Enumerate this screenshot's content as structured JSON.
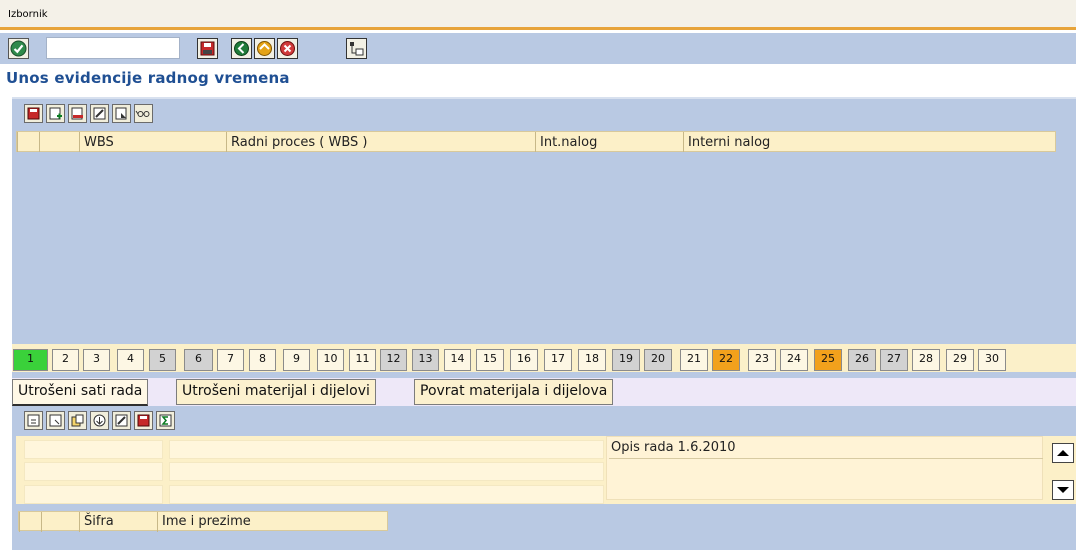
{
  "menu": {
    "label": "Izbornik"
  },
  "toolbar": {
    "command_field": {
      "value": "",
      "placeholder": ""
    },
    "buttons": [
      "save-icon",
      "back-icon",
      "exit-icon",
      "cancel-icon",
      "hierarchy-icon"
    ]
  },
  "page": {
    "title": "Unos evidencije radnog vremena"
  },
  "upper_grid": {
    "columns": [
      "WBS",
      "Radni proces ( WBS )",
      "Int.nalog",
      "Interni nalog"
    ]
  },
  "days": [
    {
      "label": "1",
      "state": "active"
    },
    {
      "label": "2",
      "state": "normal"
    },
    {
      "label": "3",
      "state": "normal"
    },
    {
      "label": "4",
      "state": "normal"
    },
    {
      "label": "5",
      "state": "weekend"
    },
    {
      "label": "6",
      "state": "weekend"
    },
    {
      "label": "7",
      "state": "normal"
    },
    {
      "label": "8",
      "state": "normal"
    },
    {
      "label": "9",
      "state": "normal"
    },
    {
      "label": "10",
      "state": "normal"
    },
    {
      "label": "11",
      "state": "normal"
    },
    {
      "label": "12",
      "state": "weekend"
    },
    {
      "label": "13",
      "state": "weekend"
    },
    {
      "label": "14",
      "state": "normal"
    },
    {
      "label": "15",
      "state": "normal"
    },
    {
      "label": "16",
      "state": "normal"
    },
    {
      "label": "17",
      "state": "normal"
    },
    {
      "label": "18",
      "state": "normal"
    },
    {
      "label": "19",
      "state": "weekend"
    },
    {
      "label": "20",
      "state": "weekend"
    },
    {
      "label": "21",
      "state": "normal"
    },
    {
      "label": "22",
      "state": "holiday"
    },
    {
      "label": "23",
      "state": "normal"
    },
    {
      "label": "24",
      "state": "normal"
    },
    {
      "label": "25",
      "state": "holiday"
    },
    {
      "label": "26",
      "state": "weekend"
    },
    {
      "label": "27",
      "state": "weekend"
    },
    {
      "label": "28",
      "state": "normal"
    },
    {
      "label": "29",
      "state": "normal"
    },
    {
      "label": "30",
      "state": "normal"
    }
  ],
  "lower_tabs": [
    "Utrošeni sati rada",
    "Utrošeni materijal i dijelovi",
    "Povrat materijala i dijelova"
  ],
  "detail": {
    "description_label": "Opis rada 1.6.2010"
  },
  "lower_grid": {
    "columns": [
      "Šifra",
      "Ime i prezime"
    ]
  },
  "colors": {
    "panel": "#b9c9e3",
    "header": "#fcf0c8",
    "active_day": "#3ad13a",
    "weekend_day": "#d2d2d2",
    "holiday_day": "#f2a11c",
    "title": "#1f4f93"
  }
}
